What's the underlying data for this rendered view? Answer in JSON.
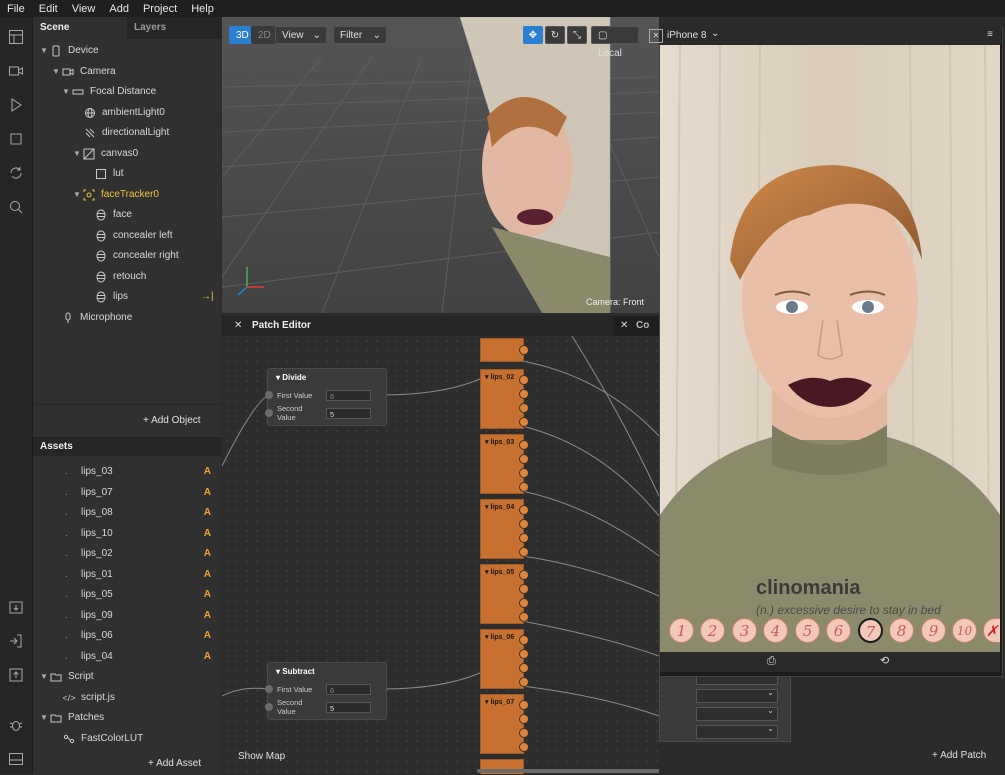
{
  "menu": [
    "File",
    "Edit",
    "View",
    "Add",
    "Project",
    "Help"
  ],
  "scene_panel": {
    "tabs": [
      "Scene",
      "Layers"
    ],
    "tree": [
      {
        "label": "Device",
        "icon": "device-icon"
      },
      {
        "label": "Camera",
        "icon": "camera-icon"
      },
      {
        "label": "Focal Distance",
        "icon": "focal-distance-icon"
      },
      {
        "label": "ambientLight0",
        "icon": "ambient-light-icon"
      },
      {
        "label": "directionalLight",
        "icon": "directional-light-icon"
      },
      {
        "label": "canvas0",
        "icon": "canvas-icon"
      },
      {
        "label": "lut",
        "icon": "rectangle-icon"
      },
      {
        "label": "faceTracker0",
        "icon": "face-tracker-icon"
      },
      {
        "label": "face",
        "icon": "face-mesh-icon"
      },
      {
        "label": "concealer left",
        "icon": "face-mesh-icon"
      },
      {
        "label": "concealer right",
        "icon": "face-mesh-icon"
      },
      {
        "label": "retouch",
        "icon": "face-mesh-icon"
      },
      {
        "label": "lips",
        "icon": "face-mesh-icon"
      },
      {
        "label": "Microphone",
        "icon": "microphone-icon"
      }
    ],
    "add_object": "Add Object"
  },
  "assets_panel": {
    "title": "Assets",
    "items": [
      {
        "label": "lips_03",
        "badge": "A"
      },
      {
        "label": "lips_07",
        "badge": "A"
      },
      {
        "label": "lips_08",
        "badge": "A"
      },
      {
        "label": "lips_10",
        "badge": "A"
      },
      {
        "label": "lips_02",
        "badge": "A"
      },
      {
        "label": "lips_01",
        "badge": "A"
      },
      {
        "label": "lips_05",
        "badge": "A"
      },
      {
        "label": "lips_09",
        "badge": "A"
      },
      {
        "label": "lips_06",
        "badge": "A"
      },
      {
        "label": "lips_04",
        "badge": "A"
      }
    ],
    "groups": [
      {
        "label": "Script"
      },
      {
        "label": "script.js"
      },
      {
        "label": "Patches"
      },
      {
        "label": "FastColorLUT"
      }
    ],
    "add_asset": "Add Asset"
  },
  "viewport": {
    "mode_3d": "3D",
    "mode_2d": "2D",
    "view_label": "View",
    "filter_label": "Filter",
    "local_label": "Local",
    "camera_label": "Camera: Front"
  },
  "patch_editor": {
    "title": "Patch Editor",
    "second_tab": "Co",
    "divide": {
      "title": "Divide",
      "first_label": "First Value",
      "first_value": "6",
      "second_label": "Second Value",
      "second_value": "5"
    },
    "subtract": {
      "title": "Subtract",
      "first_label": "First Value",
      "first_value": "6",
      "second_label": "Second Value",
      "second_value": "5"
    },
    "lips_nodes": [
      "lips_02",
      "lips_03",
      "lips_04",
      "lips_05",
      "lips_06",
      "lips_07"
    ],
    "show_map": "Show Map",
    "add_patch": "Add Patch"
  },
  "device_preview": {
    "device_name": "iPhone 8",
    "caption_title": "clinomania",
    "caption_sub": "(n.) excessive desire to stay in bed",
    "buttons": [
      "1",
      "2",
      "3",
      "4",
      "5",
      "6",
      "7",
      "8",
      "9",
      "10"
    ],
    "selected_button": "7",
    "close_glyph": "✗"
  }
}
